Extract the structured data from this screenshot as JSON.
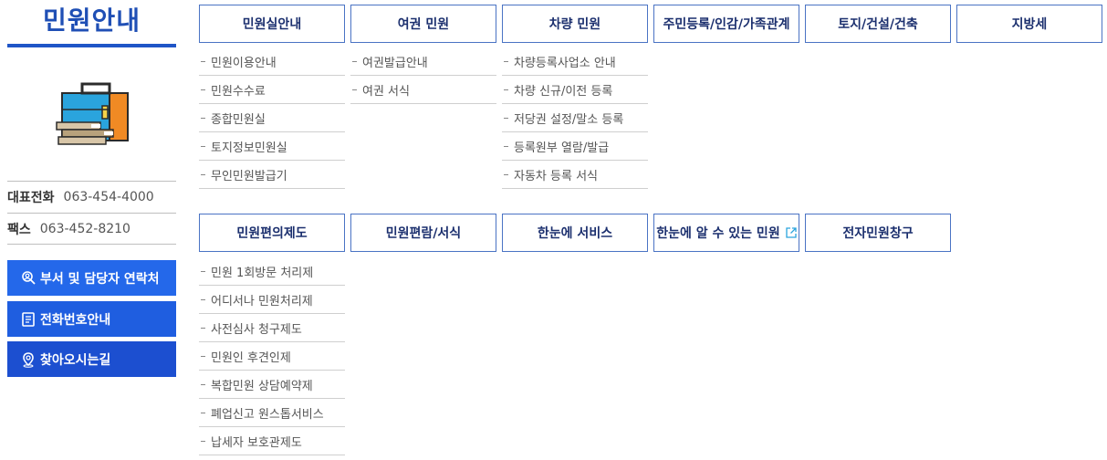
{
  "sidebar": {
    "title": "민원안내",
    "phone_label": "대표전화",
    "phone_value": "063-454-4000",
    "fax_label": "팩스",
    "fax_value": "063-452-8210",
    "buttons": [
      {
        "label": "부서 및 담당자 연락처",
        "icon": "person-search-icon"
      },
      {
        "label": "전화번호안내",
        "icon": "document-icon"
      },
      {
        "label": "찾아오시는길",
        "icon": "location-pin-icon"
      }
    ]
  },
  "menu_row1": [
    {
      "label": "민원실안내",
      "items": [
        "민원이용안내",
        "민원수수료",
        "종합민원실",
        "토지정보민원실",
        "무인민원발급기"
      ]
    },
    {
      "label": "여권 민원",
      "items": [
        "여권발급안내",
        "여권 서식"
      ]
    },
    {
      "label": "차량 민원",
      "items": [
        "차량등록사업소 안내",
        "차량 신규/이전 등록",
        "저당권 설정/말소 등록",
        "등록원부 열람/발급",
        "자동차 등록 서식"
      ]
    },
    {
      "label": "주민등록/인감/가족관계",
      "items": []
    },
    {
      "label": "토지/건설/건축",
      "items": []
    },
    {
      "label": "지방세",
      "items": []
    }
  ],
  "menu_row2": [
    {
      "label": "민원편의제도",
      "items": [
        "민원 1회방문 처리제",
        "어디서나 민원처리제",
        "사전심사 청구제도",
        "민원인 후견인제",
        "복합민원 상담예약제",
        "폐업신고 원스톱서비스",
        "납세자 보호관제도"
      ]
    },
    {
      "label": "민원편람/서식",
      "items": []
    },
    {
      "label": "한눈에 서비스",
      "items": []
    },
    {
      "label": "한눈에 알 수 있는 민원",
      "items": [],
      "external": true
    },
    {
      "label": "전자민원창구",
      "items": []
    }
  ],
  "colors": {
    "accent": "#1f55c7",
    "button_blue": "#2468ea",
    "box_border": "#4a73c4"
  }
}
